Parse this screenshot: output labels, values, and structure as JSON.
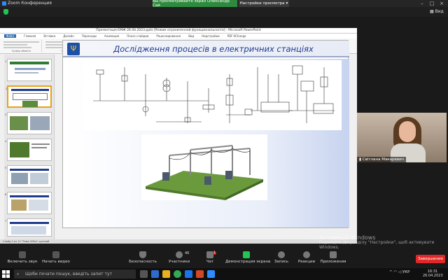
{
  "zoom": {
    "app_title": "Zoom Конференция",
    "share_banner": "Вы просматриваете экран Олександр Сай",
    "view_settings": "Настройки просмотра",
    "view_label": "Вид"
  },
  "powerpoint": {
    "window_title": "Презентація ЕМЖ 26.04.2023.pptx [Режим ограниченной функциональности] - Microsoft PowerPoint",
    "tabs": [
      "Файл",
      "Главная",
      "Вставка",
      "Дизайн",
      "Переходы",
      "Анимация",
      "Показ слайдов",
      "Рецензирование",
      "Вид",
      "Надстройки",
      "PDF-XChange"
    ],
    "ribbon_groups": [
      "Буфер обмена",
      "Слайды",
      "Шрифт",
      "Абзац",
      "Рисование",
      "Редактирование"
    ],
    "statusbar": "Слайд 2 из 12   \"Тема Office\"   русский",
    "slide_numbers": [
      "1",
      "2",
      "3",
      "4",
      "5",
      "6",
      "7"
    ]
  },
  "slide": {
    "title": "Дослідження процесів в електричних станціях",
    "emblem": "Ψ"
  },
  "participant": {
    "name": "Світлана Макаревич"
  },
  "toolbar": {
    "items": [
      {
        "label": "Включить звук",
        "name": "unmute-button"
      },
      {
        "label": "Начать видео",
        "name": "start-video-button"
      },
      {
        "label": "Безопасность",
        "name": "security-button"
      },
      {
        "label": "Участники",
        "name": "participants-button"
      },
      {
        "label": "Чат",
        "name": "chat-button"
      },
      {
        "label": "Демонстрация экрана",
        "name": "share-screen-button"
      },
      {
        "label": "Запись",
        "name": "record-button"
      },
      {
        "label": "Реакции",
        "name": "reactions-button"
      },
      {
        "label": "Приложения",
        "name": "apps-button"
      }
    ],
    "participants_count": "46",
    "chat_badge": "1",
    "end_label": "Завершение"
  },
  "watermark": {
    "line1": "Активація Windows",
    "line2": "Перейдіть до розділу \"Настройки\", щоб активувати",
    "line3": "Windows."
  },
  "taskbar": {
    "search_placeholder": "Щоби почати пошук, введіть запит тут",
    "lang": "УКР",
    "time": "16:31",
    "date": "26.04.2023"
  },
  "colors": {
    "share_banner_bg": "#2e8b3e",
    "end_button_bg": "#e02828",
    "slide_title_color": "#1f3a8a",
    "accent_blue": "#2d8cff"
  }
}
